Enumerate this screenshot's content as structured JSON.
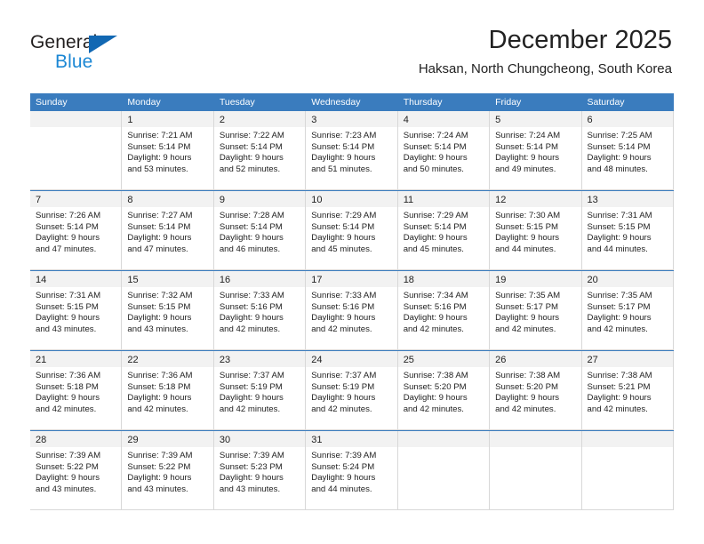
{
  "brand": {
    "name_top": "General",
    "name_bottom": "Blue",
    "accent_color": "#1b87d4",
    "triangle_color": "#1268b3"
  },
  "header": {
    "title": "December 2025",
    "subtitle": "Haksan, North Chungcheong, South Korea"
  },
  "theme": {
    "header_row_bg": "#3a7cbe",
    "daynum_band_bg": "#f2f2f2",
    "cell_border": "#d8d8d8",
    "text_color": "#222222"
  },
  "weekday_headers": [
    "Sunday",
    "Monday",
    "Tuesday",
    "Wednesday",
    "Thursday",
    "Friday",
    "Saturday"
  ],
  "weeks": [
    [
      {
        "day": "",
        "sunrise": "",
        "sunset": "",
        "daylight_1": "",
        "daylight_2": ""
      },
      {
        "day": "1",
        "sunrise": "Sunrise: 7:21 AM",
        "sunset": "Sunset: 5:14 PM",
        "daylight_1": "Daylight: 9 hours",
        "daylight_2": "and 53 minutes."
      },
      {
        "day": "2",
        "sunrise": "Sunrise: 7:22 AM",
        "sunset": "Sunset: 5:14 PM",
        "daylight_1": "Daylight: 9 hours",
        "daylight_2": "and 52 minutes."
      },
      {
        "day": "3",
        "sunrise": "Sunrise: 7:23 AM",
        "sunset": "Sunset: 5:14 PM",
        "daylight_1": "Daylight: 9 hours",
        "daylight_2": "and 51 minutes."
      },
      {
        "day": "4",
        "sunrise": "Sunrise: 7:24 AM",
        "sunset": "Sunset: 5:14 PM",
        "daylight_1": "Daylight: 9 hours",
        "daylight_2": "and 50 minutes."
      },
      {
        "day": "5",
        "sunrise": "Sunrise: 7:24 AM",
        "sunset": "Sunset: 5:14 PM",
        "daylight_1": "Daylight: 9 hours",
        "daylight_2": "and 49 minutes."
      },
      {
        "day": "6",
        "sunrise": "Sunrise: 7:25 AM",
        "sunset": "Sunset: 5:14 PM",
        "daylight_1": "Daylight: 9 hours",
        "daylight_2": "and 48 minutes."
      }
    ],
    [
      {
        "day": "7",
        "sunrise": "Sunrise: 7:26 AM",
        "sunset": "Sunset: 5:14 PM",
        "daylight_1": "Daylight: 9 hours",
        "daylight_2": "and 47 minutes."
      },
      {
        "day": "8",
        "sunrise": "Sunrise: 7:27 AM",
        "sunset": "Sunset: 5:14 PM",
        "daylight_1": "Daylight: 9 hours",
        "daylight_2": "and 47 minutes."
      },
      {
        "day": "9",
        "sunrise": "Sunrise: 7:28 AM",
        "sunset": "Sunset: 5:14 PM",
        "daylight_1": "Daylight: 9 hours",
        "daylight_2": "and 46 minutes."
      },
      {
        "day": "10",
        "sunrise": "Sunrise: 7:29 AM",
        "sunset": "Sunset: 5:14 PM",
        "daylight_1": "Daylight: 9 hours",
        "daylight_2": "and 45 minutes."
      },
      {
        "day": "11",
        "sunrise": "Sunrise: 7:29 AM",
        "sunset": "Sunset: 5:14 PM",
        "daylight_1": "Daylight: 9 hours",
        "daylight_2": "and 45 minutes."
      },
      {
        "day": "12",
        "sunrise": "Sunrise: 7:30 AM",
        "sunset": "Sunset: 5:15 PM",
        "daylight_1": "Daylight: 9 hours",
        "daylight_2": "and 44 minutes."
      },
      {
        "day": "13",
        "sunrise": "Sunrise: 7:31 AM",
        "sunset": "Sunset: 5:15 PM",
        "daylight_1": "Daylight: 9 hours",
        "daylight_2": "and 44 minutes."
      }
    ],
    [
      {
        "day": "14",
        "sunrise": "Sunrise: 7:31 AM",
        "sunset": "Sunset: 5:15 PM",
        "daylight_1": "Daylight: 9 hours",
        "daylight_2": "and 43 minutes."
      },
      {
        "day": "15",
        "sunrise": "Sunrise: 7:32 AM",
        "sunset": "Sunset: 5:15 PM",
        "daylight_1": "Daylight: 9 hours",
        "daylight_2": "and 43 minutes."
      },
      {
        "day": "16",
        "sunrise": "Sunrise: 7:33 AM",
        "sunset": "Sunset: 5:16 PM",
        "daylight_1": "Daylight: 9 hours",
        "daylight_2": "and 42 minutes."
      },
      {
        "day": "17",
        "sunrise": "Sunrise: 7:33 AM",
        "sunset": "Sunset: 5:16 PM",
        "daylight_1": "Daylight: 9 hours",
        "daylight_2": "and 42 minutes."
      },
      {
        "day": "18",
        "sunrise": "Sunrise: 7:34 AM",
        "sunset": "Sunset: 5:16 PM",
        "daylight_1": "Daylight: 9 hours",
        "daylight_2": "and 42 minutes."
      },
      {
        "day": "19",
        "sunrise": "Sunrise: 7:35 AM",
        "sunset": "Sunset: 5:17 PM",
        "daylight_1": "Daylight: 9 hours",
        "daylight_2": "and 42 minutes."
      },
      {
        "day": "20",
        "sunrise": "Sunrise: 7:35 AM",
        "sunset": "Sunset: 5:17 PM",
        "daylight_1": "Daylight: 9 hours",
        "daylight_2": "and 42 minutes."
      }
    ],
    [
      {
        "day": "21",
        "sunrise": "Sunrise: 7:36 AM",
        "sunset": "Sunset: 5:18 PM",
        "daylight_1": "Daylight: 9 hours",
        "daylight_2": "and 42 minutes."
      },
      {
        "day": "22",
        "sunrise": "Sunrise: 7:36 AM",
        "sunset": "Sunset: 5:18 PM",
        "daylight_1": "Daylight: 9 hours",
        "daylight_2": "and 42 minutes."
      },
      {
        "day": "23",
        "sunrise": "Sunrise: 7:37 AM",
        "sunset": "Sunset: 5:19 PM",
        "daylight_1": "Daylight: 9 hours",
        "daylight_2": "and 42 minutes."
      },
      {
        "day": "24",
        "sunrise": "Sunrise: 7:37 AM",
        "sunset": "Sunset: 5:19 PM",
        "daylight_1": "Daylight: 9 hours",
        "daylight_2": "and 42 minutes."
      },
      {
        "day": "25",
        "sunrise": "Sunrise: 7:38 AM",
        "sunset": "Sunset: 5:20 PM",
        "daylight_1": "Daylight: 9 hours",
        "daylight_2": "and 42 minutes."
      },
      {
        "day": "26",
        "sunrise": "Sunrise: 7:38 AM",
        "sunset": "Sunset: 5:20 PM",
        "daylight_1": "Daylight: 9 hours",
        "daylight_2": "and 42 minutes."
      },
      {
        "day": "27",
        "sunrise": "Sunrise: 7:38 AM",
        "sunset": "Sunset: 5:21 PM",
        "daylight_1": "Daylight: 9 hours",
        "daylight_2": "and 42 minutes."
      }
    ],
    [
      {
        "day": "28",
        "sunrise": "Sunrise: 7:39 AM",
        "sunset": "Sunset: 5:22 PM",
        "daylight_1": "Daylight: 9 hours",
        "daylight_2": "and 43 minutes."
      },
      {
        "day": "29",
        "sunrise": "Sunrise: 7:39 AM",
        "sunset": "Sunset: 5:22 PM",
        "daylight_1": "Daylight: 9 hours",
        "daylight_2": "and 43 minutes."
      },
      {
        "day": "30",
        "sunrise": "Sunrise: 7:39 AM",
        "sunset": "Sunset: 5:23 PM",
        "daylight_1": "Daylight: 9 hours",
        "daylight_2": "and 43 minutes."
      },
      {
        "day": "31",
        "sunrise": "Sunrise: 7:39 AM",
        "sunset": "Sunset: 5:24 PM",
        "daylight_1": "Daylight: 9 hours",
        "daylight_2": "and 44 minutes."
      },
      {
        "day": "",
        "sunrise": "",
        "sunset": "",
        "daylight_1": "",
        "daylight_2": ""
      },
      {
        "day": "",
        "sunrise": "",
        "sunset": "",
        "daylight_1": "",
        "daylight_2": ""
      },
      {
        "day": "",
        "sunrise": "",
        "sunset": "",
        "daylight_1": "",
        "daylight_2": ""
      }
    ]
  ]
}
